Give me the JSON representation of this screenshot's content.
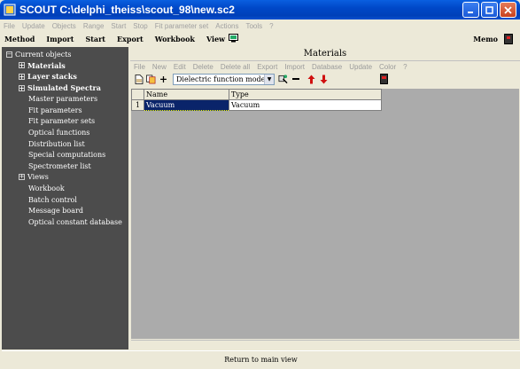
{
  "window": {
    "title": "SCOUT C:\\delphi_theiss\\scout_98\\new.sc2"
  },
  "menubar": [
    "File",
    "Update",
    "Objects",
    "Range",
    "Start",
    "Stop",
    "Fit parameter set",
    "Actions",
    "Tools",
    "?"
  ],
  "toolbar": {
    "items": [
      "Method",
      "Import",
      "Start",
      "Export",
      "Workbook",
      "View"
    ],
    "memo_label": "Memo"
  },
  "tree": {
    "root": "Current objects",
    "items": [
      {
        "label": "Materials",
        "bold": true,
        "expander": true
      },
      {
        "label": "Layer stacks",
        "bold": true,
        "expander": true
      },
      {
        "label": "Simulated Spectra",
        "bold": true,
        "expander": true
      },
      {
        "label": "Master parameters",
        "bold": false,
        "expander": false
      },
      {
        "label": "Fit parameters",
        "bold": false,
        "expander": false
      },
      {
        "label": "Fit parameter sets",
        "bold": false,
        "expander": false
      },
      {
        "label": "Optical functions",
        "bold": false,
        "expander": false
      },
      {
        "label": "Distribution list",
        "bold": false,
        "expander": false
      },
      {
        "label": "Special computations",
        "bold": false,
        "expander": false
      },
      {
        "label": "Spectrometer list",
        "bold": false,
        "expander": false
      },
      {
        "label": "Views",
        "bold": false,
        "expander": true
      },
      {
        "label": "Workbook",
        "bold": false,
        "expander": false
      },
      {
        "label": "Batch control",
        "bold": false,
        "expander": false
      },
      {
        "label": "Message board",
        "bold": false,
        "expander": false
      },
      {
        "label": "Optical constant database",
        "bold": false,
        "expander": false
      }
    ]
  },
  "panel": {
    "title": "Materials",
    "menu": [
      "File",
      "New",
      "Edit",
      "Delete",
      "Delete all",
      "Export",
      "Import",
      "Database",
      "Update",
      "Color",
      "?"
    ],
    "type_select": "Dielectric function model",
    "grid": {
      "headers": [
        "Name",
        "Type"
      ],
      "rows": [
        {
          "num": "1",
          "name": "Vacuum",
          "type": "Vacuum"
        }
      ]
    }
  },
  "status": {
    "button_label": "Return to main view"
  }
}
